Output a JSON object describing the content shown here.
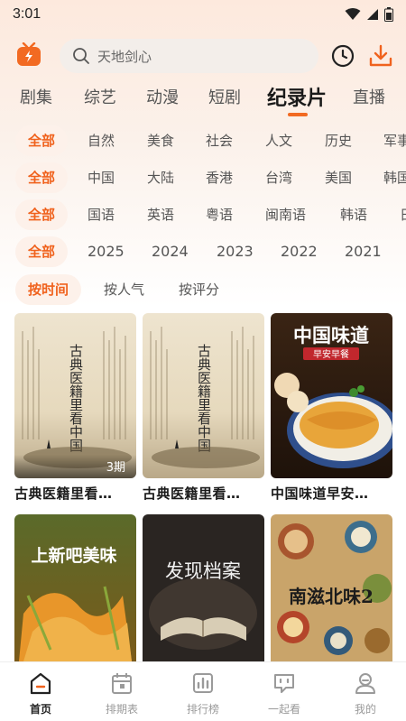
{
  "status": {
    "time": "3:01"
  },
  "search": {
    "placeholder": "天地剑心"
  },
  "categories": [
    {
      "label": "剧集"
    },
    {
      "label": "综艺"
    },
    {
      "label": "动漫"
    },
    {
      "label": "短剧"
    },
    {
      "label": "纪录片"
    },
    {
      "label": "直播"
    }
  ],
  "active_category": "纪录片",
  "filters": {
    "genre": [
      "全部",
      "自然",
      "美食",
      "社会",
      "人文",
      "历史",
      "军事"
    ],
    "region": [
      "全部",
      "中国",
      "大陆",
      "香港",
      "台湾",
      "美国",
      "韩国"
    ],
    "language": [
      "全部",
      "国语",
      "英语",
      "粤语",
      "闽南语",
      "韩语",
      "日语"
    ],
    "year": [
      "全部",
      "2025",
      "2024",
      "2023",
      "2022",
      "2021"
    ],
    "sort": [
      "按时间",
      "按人气",
      "按评分"
    ]
  },
  "cards": [
    {
      "title": "古典医籍里看…",
      "badge": "3期",
      "poster_text": "古典医籍里看中国"
    },
    {
      "title": "古典医籍里看…",
      "badge": "",
      "poster_text": "古典医籍里看中国"
    },
    {
      "title": "中国味道早安…",
      "badge": "",
      "poster_text": "中国味道",
      "poster_sub": "早安早餐"
    },
    {
      "title": "",
      "badge": "",
      "poster_text": "上新吧美味"
    },
    {
      "title": "",
      "badge": "",
      "poster_text": "发现档案"
    },
    {
      "title": "",
      "badge": "",
      "poster_text": "南滋北味2"
    }
  ],
  "bottom_nav": [
    {
      "label": "首页",
      "icon": "home-icon"
    },
    {
      "label": "排期表",
      "icon": "calendar-icon"
    },
    {
      "label": "排行榜",
      "icon": "ranking-icon"
    },
    {
      "label": "一起看",
      "icon": "watch-together-icon"
    },
    {
      "label": "我的",
      "icon": "profile-icon"
    }
  ],
  "colors": {
    "accent": "#f0621d",
    "chip_bg": "#fdf1ea"
  }
}
